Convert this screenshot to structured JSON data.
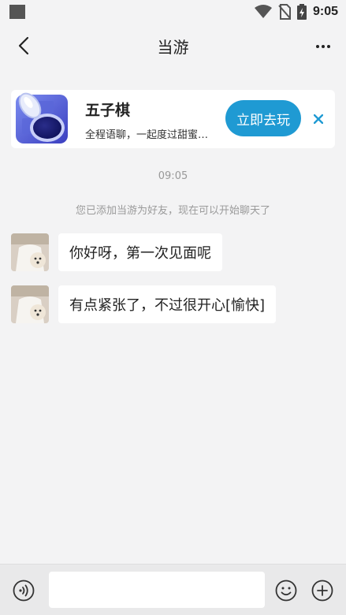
{
  "status_bar": {
    "time": "9:05"
  },
  "header": {
    "title": "当游"
  },
  "game_card": {
    "name": "五子棋",
    "description": "全程语聊，一起度过甜蜜…",
    "play_label": "立即去玩",
    "accent": "#1f9ad3"
  },
  "chat": {
    "timestamp": "09:05",
    "system_notice": "您已添加当游为好友，现在可以开始聊天了",
    "messages": [
      {
        "text": "你好呀，第一次见面呢"
      },
      {
        "text": "有点紧张了，不过很开心[愉快]"
      }
    ]
  },
  "input_bar": {
    "placeholder": ""
  },
  "icons": {
    "back": "chevron-left-icon",
    "more": "more-dots-icon",
    "close": "close-icon",
    "voice": "voice-icon",
    "emoji": "emoji-icon",
    "plus": "plus-icon"
  }
}
